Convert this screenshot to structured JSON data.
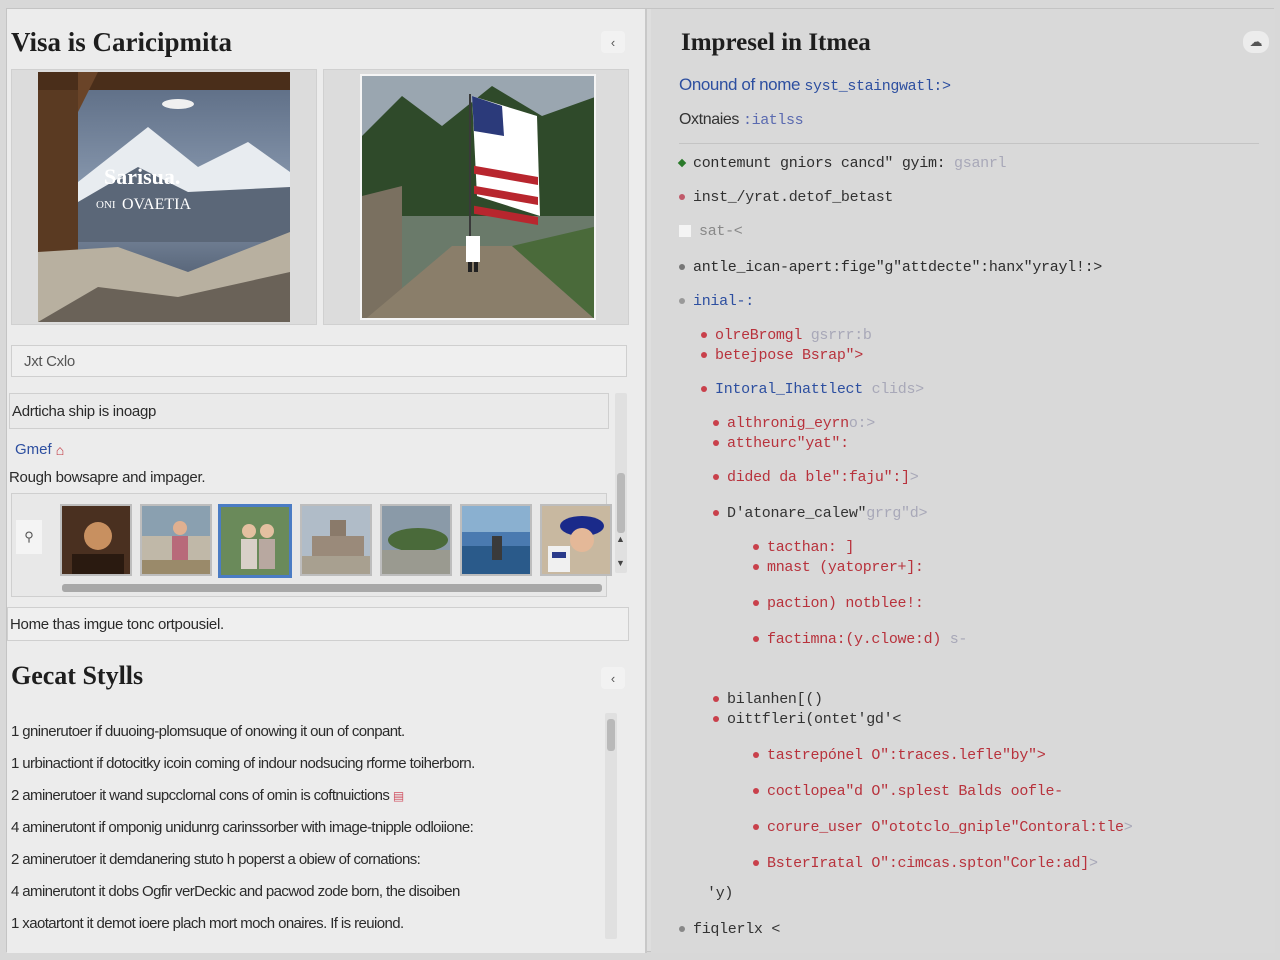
{
  "left_panel": {
    "title": "Visa is Caricipmita",
    "collapse_icon": "chevron-left-icon",
    "image_one_overlay": {
      "line1": "Sarisua.",
      "line2": "OVAETIA",
      "prefix": "ONI"
    },
    "input_value": "Jxt Cxlo",
    "description_heading": "Adrticha ship is inoagp",
    "link_label": "Gmef",
    "link_icon": "home-icon",
    "subheading": "Rough bowsapre and impager.",
    "search_icon": "search-icon",
    "thumbnails": [
      "t1",
      "t2",
      "t3",
      "t4",
      "t5",
      "t6",
      "t7"
    ],
    "caption": "Home thas imgue tonc ortpousiel.",
    "styles_title": "Gecat Stylls",
    "styles_lines": [
      "1 gninerutoer if duuoing-plomsuque of onowing it oun of conpant.",
      "1 urbinactiont if dotocitky icoin coming of indour nodsucing rforme toiherborn.",
      "2 aminerutoer it wand supcclornal cons of omin is coftnuictions",
      "4 aminerutont if omponig unidunrg carinssorber with image-tnipple odloiione:",
      "2 aminerutoer it demdanering stuto h poperst a obiew of cornations:",
      "4 aminerutont it dobs Ogfir verDeckic and pacwod zode born, the disoiben",
      "1 xaotartont it demot ioere plach mort moch onaires. If is reuiond."
    ]
  },
  "right_panel": {
    "title": "Impresel in Itmea",
    "collapse_icon": "cloud-icon",
    "line1_a": "Onound of nome ",
    "line1_b": "syst_staingwatl:>",
    "line2_a": "Oxtnaies ",
    "line2_b": ":iatlss",
    "code_lines": [
      {
        "text": "contemunt gniors cancd\" gyim:",
        "tail": " gsanrl",
        "color": "#2e2e2e",
        "bullet": "#2a7a2a",
        "indent": 0
      },
      {
        "text": "inst_/yrat.detof_betast",
        "tail": "",
        "color": "#333",
        "bullet": "#c05a6a",
        "indent": 0
      },
      {
        "text": "sat-<",
        "tail": "",
        "color": "#888",
        "bullet": "sq",
        "indent": 0
      },
      {
        "text": "antle_ican-apert:fige\"g\"attdecte\":hanx\"yrayl!:>",
        "tail": "",
        "color": "#2e2e2e",
        "bullet": "#777",
        "indent": 0
      },
      {
        "text": "inial-:",
        "tail": "",
        "color": "#2d4fa0",
        "bullet": "#999",
        "indent": 0
      },
      {
        "text": "olreBromgl",
        "tail": " gsrrr:b",
        "color": "#b8323c",
        "bullet": "#c9404b",
        "indent": 1
      },
      {
        "text": "betejpose Bsrap\">",
        "tail": "",
        "color": "#b8323c",
        "bullet": "#c9404b",
        "indent": 1
      },
      {
        "text": "Intoral_Ihattlect",
        "tail": " clids>",
        "color": "#2d4fa0",
        "bullet": "#c9404b",
        "indent": 1
      },
      {
        "text": "althronig_eyrn",
        "tail": "o:>",
        "color": "#b8323c",
        "bullet": "#c9404b",
        "indent": 2
      },
      {
        "text": "attheurc\"yat\":",
        "tail": "",
        "color": "#b8323c",
        "bullet": "#c9404b",
        "indent": 2
      },
      {
        "text": "dided da ble\":faju\":]",
        "tail": ">",
        "color": "#b8323c",
        "bullet": "#c9404b",
        "indent": 2
      },
      {
        "text": "D'atonare_calew\"",
        "tail": "grrg\"d>",
        "color": "#333",
        "bullet": "#c9404b",
        "indent": 2
      },
      {
        "text": "tacthan: ]",
        "tail": "",
        "color": "#b8323c",
        "bullet": "#c9404b",
        "indent": 3
      },
      {
        "text": "mnast (yatoprer+]:",
        "tail": "",
        "color": "#b8323c",
        "bullet": "#c9404b",
        "indent": 3
      },
      {
        "text": "paction) notblee!:",
        "tail": "",
        "color": "#b8323c",
        "bullet": "#c9404b",
        "indent": 3
      },
      {
        "text": "factimna:(y.clowe:d)",
        "tail": " s-",
        "color": "#b8323c",
        "bullet": "#c9404b",
        "indent": 3
      },
      {
        "text": "bilanhen[()",
        "tail": "",
        "color": "#333",
        "bullet": "#c9404b",
        "indent": 2
      },
      {
        "text": "oittfleri(ontet'gd'<",
        "tail": "",
        "color": "#333",
        "bullet": "#c9404b",
        "indent": 2
      },
      {
        "text": "tastrepónel O\":traces.lefle\"by\">",
        "tail": "",
        "color": "#b8323c",
        "bullet": "#c9404b",
        "indent": 3
      },
      {
        "text": "coctlopea\"d O\".splest Balds oofle-",
        "tail": "",
        "color": "#b8323c",
        "bullet": "#c9404b",
        "indent": 3
      },
      {
        "text": "corure_user O\"ototclo_gniple\"Contoral:tle",
        "tail": ">",
        "color": "#b8323c",
        "bullet": "#c9404b",
        "indent": 3
      },
      {
        "text": "BsterIratal O\":cimcas.spton\"Corle:ad]",
        "tail": ">",
        "color": "#b8323c",
        "bullet": "#c9404b",
        "indent": 3
      },
      {
        "text": "'y)",
        "tail": "",
        "color": "#333",
        "bullet": "none",
        "indent": 1
      },
      {
        "text": "fiqlerlx <",
        "tail": "",
        "color": "#333",
        "bullet": "#888",
        "indent": 0
      }
    ]
  }
}
